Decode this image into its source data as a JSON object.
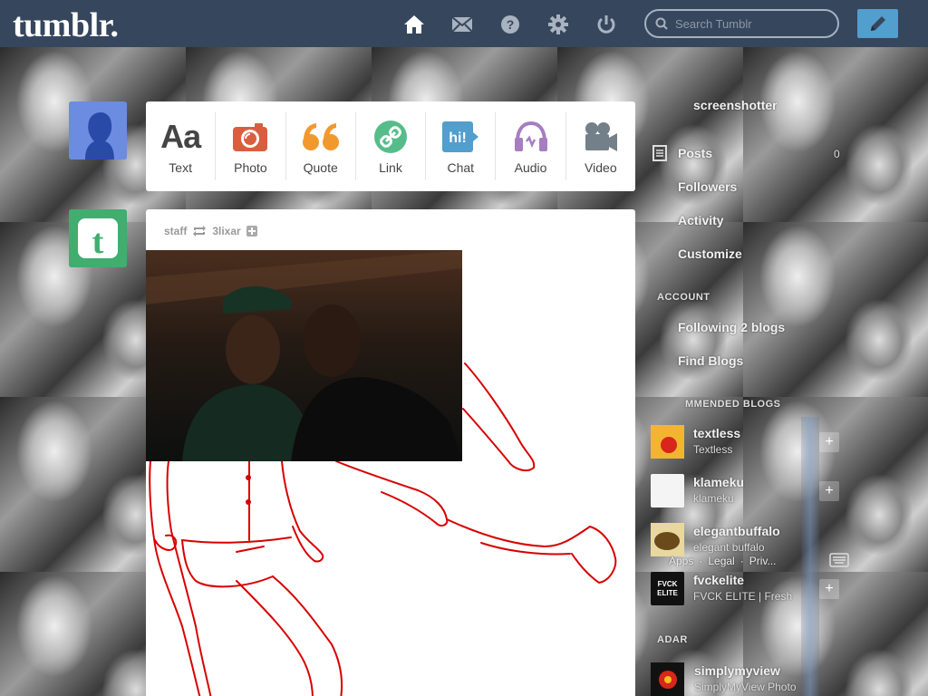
{
  "header": {
    "logo": "tumblr.",
    "search_placeholder": "Search Tumblr",
    "nav_icons": [
      "home-icon",
      "mail-icon",
      "help-icon",
      "gear-icon",
      "power-icon"
    ],
    "compose_icon": "pencil-icon",
    "bg_color": "#36465d",
    "accent_color": "#529ecc"
  },
  "post_types": [
    {
      "label": "Text",
      "icon": "text-icon",
      "color": "#444444"
    },
    {
      "label": "Photo",
      "icon": "camera-icon",
      "color": "#d95e40"
    },
    {
      "label": "Quote",
      "icon": "quote-icon",
      "color": "#f2992e"
    },
    {
      "label": "Link",
      "icon": "link-icon",
      "color": "#56bc8a"
    },
    {
      "label": "Chat",
      "icon": "chat-icon",
      "color": "#529ecc"
    },
    {
      "label": "Audio",
      "icon": "headphones-icon",
      "color": "#a77dc2"
    },
    {
      "label": "Video",
      "icon": "video-camera-icon",
      "color": "#748089"
    }
  ],
  "post": {
    "author": "staff",
    "reblog_icon": "reblog-icon",
    "source": "3lixar",
    "follow_icon": "plus-icon"
  },
  "sidebar": {
    "blog_name": "screenshotter",
    "items": [
      {
        "label": "Posts",
        "count": "0",
        "icon": "document-icon"
      },
      {
        "label": "Followers"
      },
      {
        "label": "Activity"
      },
      {
        "label": "Customize"
      }
    ],
    "account_heading": "ACCOUNT",
    "account_items": [
      {
        "label": "Following 2 blogs"
      },
      {
        "label": "Find Blogs"
      }
    ],
    "recommended_heading": "MMENDED BLOGS",
    "recommended": [
      {
        "name": "textless",
        "sub": "Textless",
        "color": "#f0a020"
      },
      {
        "name": "klameku",
        "sub": "klameku",
        "color": "#f4f4f4"
      },
      {
        "name": "elegantbuffalo",
        "sub": "elegant buffalo",
        "color": "#8a6a2a"
      },
      {
        "name": "fvckelite",
        "sub": "FVCK ELITE | Fresh",
        "color": "#111111",
        "logo_text": "FVCK ELITE"
      }
    ],
    "radar_heading": "ADAR",
    "radar": {
      "name": "simplymyview",
      "sub": "SimplyMyView Photo"
    },
    "footer_links": [
      "Apps",
      "Legal",
      "Priv..."
    ]
  }
}
